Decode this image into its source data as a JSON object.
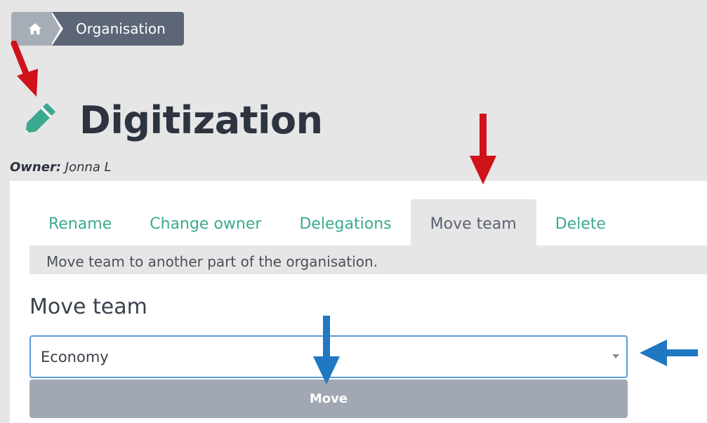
{
  "breadcrumb": {
    "home_icon": "home-icon",
    "current": "Organisation"
  },
  "page": {
    "title": "Digitization",
    "edit_icon": "pencil-icon",
    "owner_label": "Owner:",
    "owner_name": "Jonna L"
  },
  "tabs": [
    {
      "label": "Rename",
      "active": false
    },
    {
      "label": "Change owner",
      "active": false
    },
    {
      "label": "Delegations",
      "active": false
    },
    {
      "label": "Move team",
      "active": true
    },
    {
      "label": "Delete",
      "active": false
    }
  ],
  "tab_description": "Move team to another part of the organisation.",
  "move_section": {
    "title": "Move team",
    "select_value": "Economy",
    "button_label": "Move"
  },
  "colors": {
    "accent": "#3aaa8f",
    "breadcrumb_dark": "#5d6676",
    "breadcrumb_light": "#a7adb7",
    "annotation_red": "#d0121b",
    "annotation_blue": "#1f78c1"
  }
}
